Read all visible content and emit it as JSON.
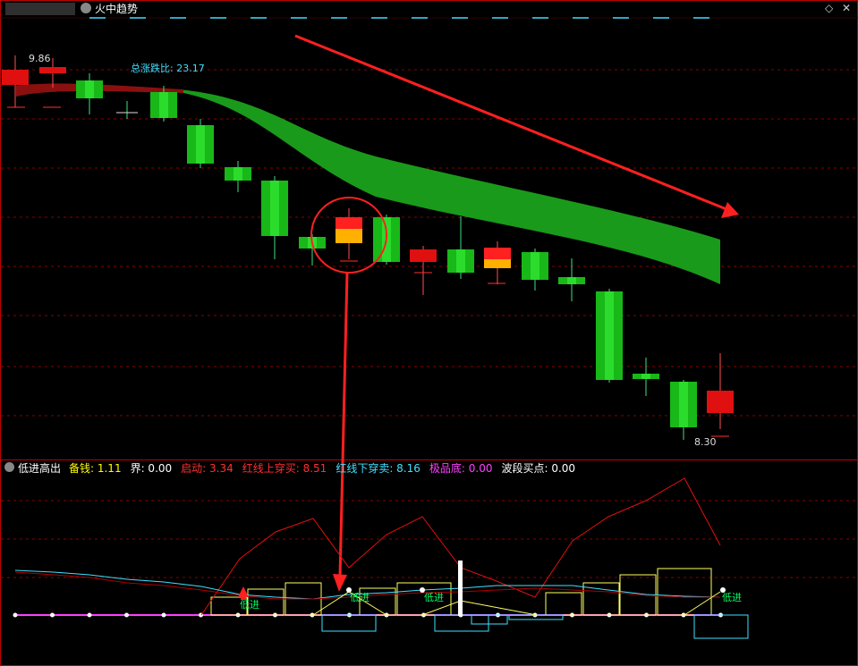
{
  "top_panel": {
    "title": "火中趋势",
    "high_label": "9.86",
    "low_label": "8.30",
    "change_label": "总涨跌比:",
    "change_value": "23.17"
  },
  "bottom_panel": {
    "title": "低进高出",
    "indicators": [
      {
        "label": "备钱:",
        "value": "1.11",
        "color": "#ffff00"
      },
      {
        "label": "界:",
        "value": "0.00",
        "color": "#ffffff"
      },
      {
        "label": "启动:",
        "value": "3.34",
        "color": "#ff3030"
      },
      {
        "label": "红线上穿买:",
        "value": "8.51",
        "color": "#ff3030"
      },
      {
        "label": "红线下穿卖:",
        "value": "8.16",
        "color": "#40e0ff"
      },
      {
        "label": "极品底:",
        "value": "0.00",
        "color": "#ff40ff"
      },
      {
        "label": "波段买点:",
        "value": "0.00",
        "color": "#ffffff"
      }
    ],
    "signal_label": "低进",
    "signals": [
      "低进",
      "低进",
      "低进",
      "低进"
    ]
  },
  "colors": {
    "up": "#ff1010",
    "down": "#10c010",
    "frame": "#c00000",
    "cloud": "#1a9a1a",
    "signal": "#00ff66",
    "cyan": "#40e0ff",
    "magenta": "#ff40ff"
  },
  "icons": {
    "collapse": "chevron-down-icon",
    "settings": "diamond-icon",
    "close": "close-icon"
  }
}
